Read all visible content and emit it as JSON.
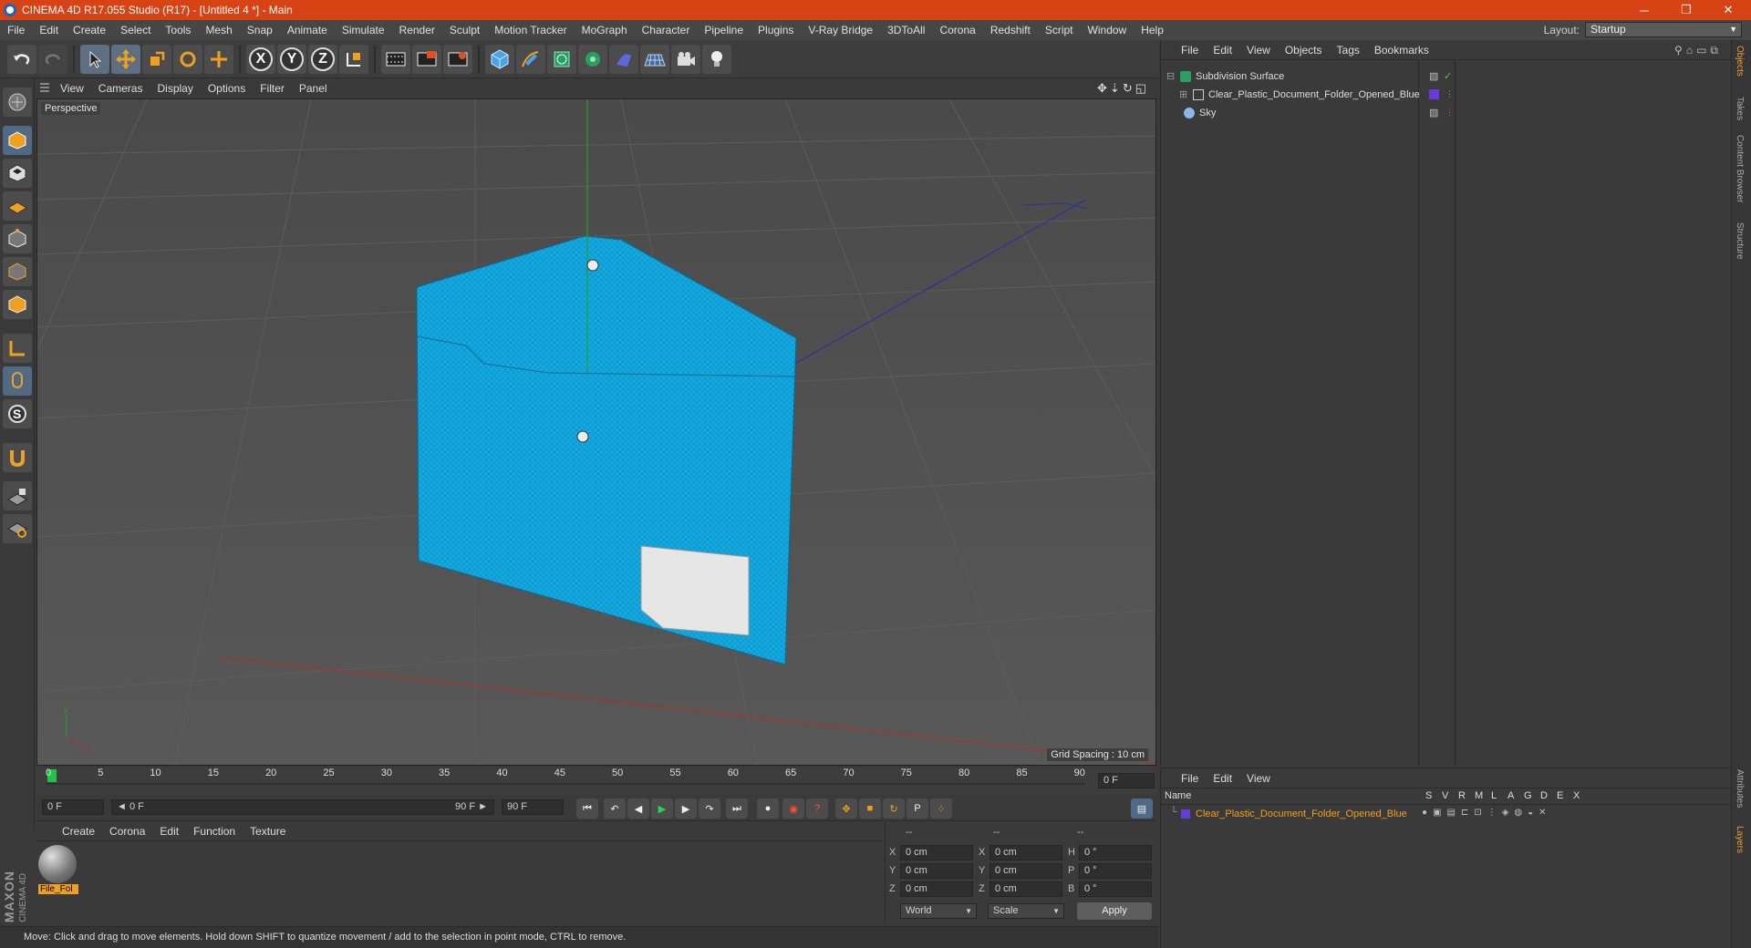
{
  "window": {
    "title": "CINEMA 4D R17.055 Studio (R17) - [Untitled 4 *] - Main",
    "controls": [
      "─",
      "❐",
      "✕"
    ]
  },
  "menubar": {
    "items": [
      "File",
      "Edit",
      "Create",
      "Select",
      "Tools",
      "Mesh",
      "Snap",
      "Animate",
      "Simulate",
      "Render",
      "Sculpt",
      "Motion Tracker",
      "MoGraph",
      "Character",
      "Pipeline",
      "Plugins",
      "V-Ray Bridge",
      "3DToAll",
      "Corona",
      "Redshift",
      "Script",
      "Window",
      "Help"
    ],
    "layout_label": "Layout:",
    "layout_value": "Startup"
  },
  "toolbar": {
    "icons": [
      "undo-icon",
      "redo-icon",
      "select-arrow-icon",
      "move-icon",
      "scale-icon",
      "rotate-icon",
      "transform-icon",
      "x-axis-icon",
      "y-axis-icon",
      "z-axis-icon",
      "coordinate-system-icon",
      "render-view-icon",
      "render-picture-viewer-icon",
      "render-settings-icon",
      "cube-icon",
      "pen-icon",
      "subdivision-icon",
      "cloner-icon",
      "deformer-icon",
      "floor-icon",
      "camera-icon",
      "light-icon"
    ],
    "axis_x": "X",
    "axis_y": "Y",
    "axis_z": "Z"
  },
  "viewport": {
    "menu": [
      "View",
      "Cameras",
      "Display",
      "Options",
      "Filter",
      "Panel"
    ],
    "label": "Perspective",
    "grid_spacing": "Grid Spacing : 10 cm",
    "colors": {
      "folder": "#12a9e0",
      "label_patch": "#e6e6e6",
      "y_axis": "#2a9d2a",
      "z_axis": "#2f2fa0",
      "x_axis": "#a83232"
    }
  },
  "timeline": {
    "ticks": [
      "0",
      "5",
      "10",
      "15",
      "20",
      "25",
      "30",
      "35",
      "40",
      "45",
      "50",
      "55",
      "60",
      "65",
      "70",
      "75",
      "80",
      "85",
      "90"
    ],
    "current_frame": "0 F",
    "start_frame": "0 F",
    "range_start": "◄ 0 F",
    "range_end": "90 F ►",
    "end_frame": "90 F"
  },
  "material_manager": {
    "menu": [
      "Create",
      "Corona",
      "Edit",
      "Function",
      "Texture"
    ],
    "material_name": "File_Fol"
  },
  "coordinates": {
    "header": [
      "--",
      "--",
      "--"
    ],
    "rows": [
      {
        "a": "X",
        "av": "0 cm",
        "b": "X",
        "bv": "0 cm",
        "c": "H",
        "cv": "0 °"
      },
      {
        "a": "Y",
        "av": "0 cm",
        "b": "Y",
        "bv": "0 cm",
        "c": "P",
        "cv": "0 °"
      },
      {
        "a": "Z",
        "av": "0 cm",
        "b": "Z",
        "bv": "0 cm",
        "c": "B",
        "cv": "0 °"
      }
    ],
    "mode": "World",
    "size_mode": "Scale",
    "apply": "Apply"
  },
  "object_manager": {
    "menu": [
      "File",
      "Edit",
      "View",
      "Objects",
      "Tags",
      "Bookmarks"
    ],
    "objects": [
      "Subdivision Surface",
      "Clear_Plastic_Document_Folder_Opened_Blue",
      "Sky"
    ]
  },
  "right_tabs": [
    "Objects",
    "Takes",
    "Content Browser",
    "Structure",
    "Attributes",
    "Layers"
  ],
  "layer_manager": {
    "menu": [
      "File",
      "Edit",
      "View"
    ],
    "columns": [
      "Name",
      "S",
      "V",
      "R",
      "M",
      "L",
      "A",
      "G",
      "D",
      "E",
      "X"
    ],
    "layer_name": "Clear_Plastic_Document_Folder_Opened_Blue"
  },
  "status": "Move: Click and drag to move elements. Hold down SHIFT to quantize movement / add to the selection in point mode, CTRL to remove.",
  "brand": {
    "maxon": "MAXON",
    "c4d": "CINEMA 4D"
  }
}
